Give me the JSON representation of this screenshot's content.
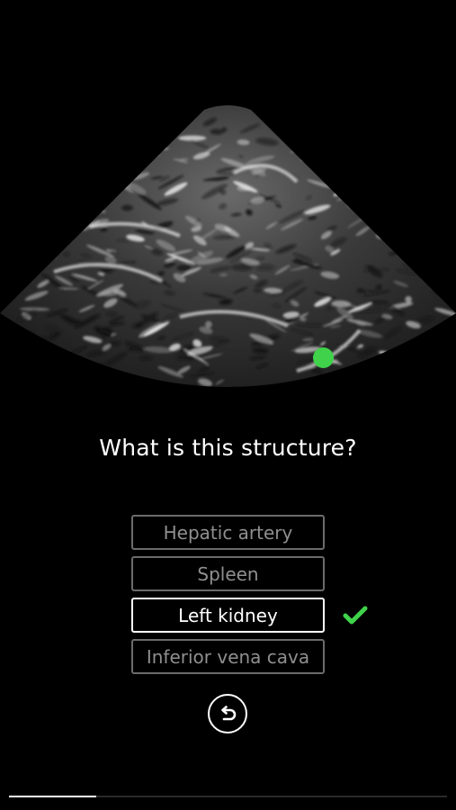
{
  "quiz": {
    "question": "What is this structure?",
    "options": [
      {
        "label": "Hepatic artery",
        "state": "default"
      },
      {
        "label": "Spleen",
        "state": "default"
      },
      {
        "label": "Left kidney",
        "state": "correct"
      },
      {
        "label": "Inferior vena cava",
        "state": "default"
      }
    ]
  },
  "progress": {
    "fraction": 0.2
  },
  "colors": {
    "marker": "#3fd24a",
    "check": "#3fd24a",
    "background": "#000000"
  },
  "icons": {
    "correct": "checkmark-icon",
    "undo": "undo-arrow-icon",
    "marker": "target-dot"
  }
}
